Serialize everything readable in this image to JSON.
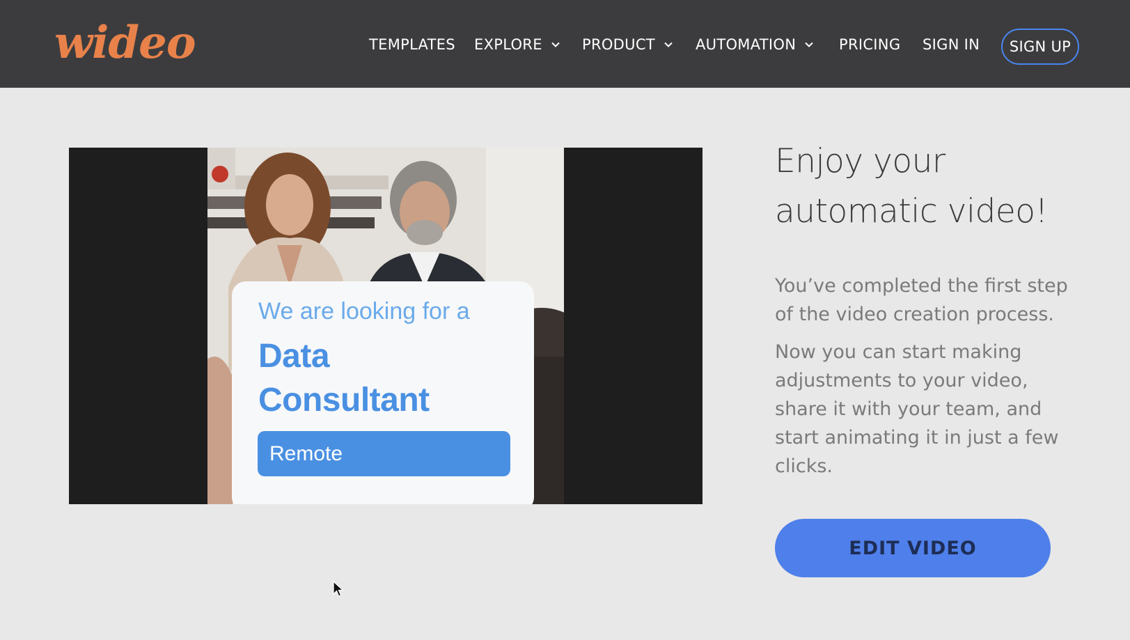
{
  "header": {
    "logo": "wideo",
    "nav": [
      {
        "label": "TEMPLATES",
        "dropdown": false
      },
      {
        "label": "EXPLORE",
        "dropdown": true
      },
      {
        "label": "PRODUCT",
        "dropdown": true
      },
      {
        "label": "AUTOMATION",
        "dropdown": true
      },
      {
        "label": "PRICING",
        "dropdown": false
      },
      {
        "label": "SIGN IN",
        "dropdown": false
      }
    ],
    "signup_label": "SIGN UP"
  },
  "video": {
    "card_pre": "We are looking for a",
    "card_title_line1": "Data",
    "card_title_line2": "Consultant",
    "card_pill": "Remote"
  },
  "main": {
    "headline_line1": "Enjoy your",
    "headline_line2": "automatic video!",
    "para1": "You’ve completed the first step of the video creation process.",
    "para2": "Now you can start making adjustments to your video, share it with your team, and start animating it in just a few clicks.",
    "edit_button": "EDIT VIDEO"
  },
  "colors": {
    "header_bg": "#3c3c3e",
    "logo": "#e8824a",
    "accent_blue": "#4f7fea",
    "page_bg": "#e8e8e8"
  }
}
